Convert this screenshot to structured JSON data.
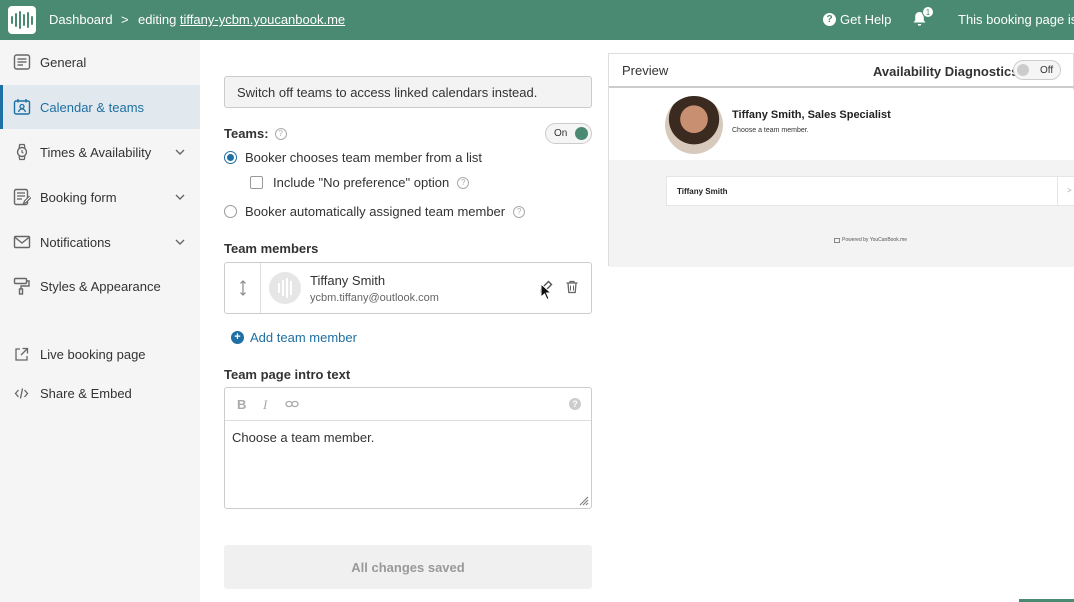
{
  "topbar": {
    "dashboard": "Dashboard",
    "separator": ">",
    "editing_prefix": "editing ",
    "editing_link": "tiffany-ycbm.youcanbook.me",
    "help": "Get Help",
    "notification_count": "1",
    "status": "This booking page is"
  },
  "sidebar": {
    "items": [
      {
        "label": "General",
        "icon": "list-icon"
      },
      {
        "label": "Calendar & teams",
        "icon": "calendar-person-icon"
      },
      {
        "label": "Times & Availability",
        "icon": "watch-icon"
      },
      {
        "label": "Booking form",
        "icon": "form-icon"
      },
      {
        "label": "Notifications",
        "icon": "envelope-icon"
      },
      {
        "label": "Styles & Appearance",
        "icon": "paint-roller-icon"
      },
      {
        "label": "Live booking page",
        "icon": "external-link-icon"
      },
      {
        "label": "Share & Embed",
        "icon": "code-icon"
      }
    ]
  },
  "main": {
    "notice": "Switch off teams to access linked calendars instead.",
    "teams_label": "Teams:",
    "teams_toggle": "On",
    "radio_list": "Booker chooses team member from a list",
    "checkbox_no_pref": "Include \"No preference\" option",
    "radio_auto": "Booker automatically assigned team member",
    "team_members_label": "Team members",
    "member": {
      "name": "Tiffany Smith",
      "email": "ycbm.tiffany@outlook.com"
    },
    "add_member": "Add team member",
    "intro_label": "Team page intro text",
    "toolbar": {
      "bold": "B",
      "italic": "I"
    },
    "intro_text": "Choose a team member.",
    "saved": "All changes saved"
  },
  "preview": {
    "title": "Preview",
    "diagnostics": "Availability Diagnostics",
    "diagnostics_toggle": "Off",
    "name": "Tiffany Smith, Sales Specialist",
    "sub": "Choose a team member.",
    "row_name": "Tiffany Smith",
    "row_chevron": ">",
    "powered": "Powered by YouCanBook.me"
  },
  "colors": {
    "brand": "#4a8a73",
    "accent": "#1e6fa3",
    "sidebar_bg": "#f5f5f5",
    "active_bg": "#e1e9ef"
  }
}
